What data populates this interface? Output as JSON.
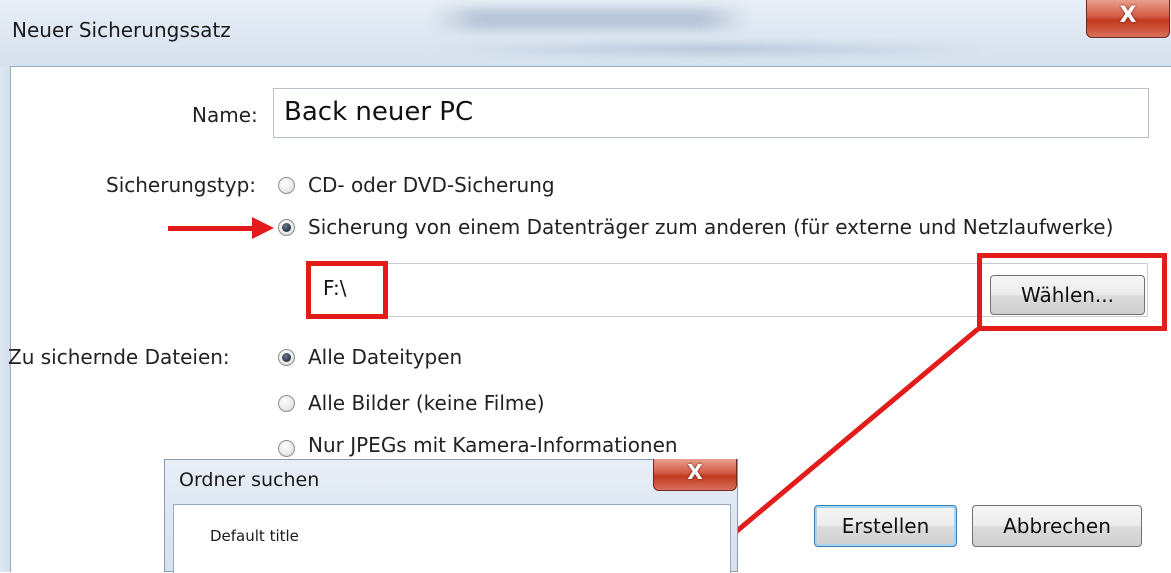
{
  "window": {
    "title": "Neuer Sicherungssatz",
    "close_glyph": "X"
  },
  "form": {
    "name_label": "Name:",
    "name_value": "Back neuer PC",
    "type_label": "Sicherungstyp:",
    "type_options": [
      {
        "label": "CD- oder DVD-Sicherung",
        "selected": false
      },
      {
        "label": "Sicherung von einem Datenträger zum anderen (für externe und Netzlaufwerke)",
        "selected": true
      }
    ],
    "path_value": "F:\\",
    "choose_button": "Wählen...",
    "files_label": "Zu sichernde Dateien:",
    "file_options": [
      {
        "label": "Alle Dateitypen",
        "selected": true
      },
      {
        "label": "Alle Bilder (keine Filme)",
        "selected": false
      },
      {
        "label": "Nur JPEGs mit Kamera-Informationen",
        "selected": false
      }
    ],
    "create_button": "Erstellen",
    "cancel_button": "Abbrechen"
  },
  "folder_dialog": {
    "title": "Ordner suchen",
    "close_glyph": "X",
    "body_text": "Default title"
  },
  "annotations": {
    "color": "#e21b1b"
  }
}
